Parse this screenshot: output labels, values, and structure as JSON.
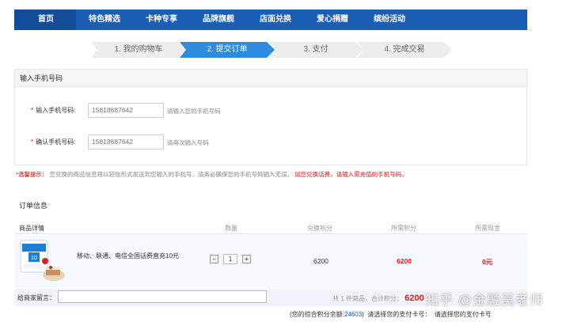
{
  "nav": [
    "首页",
    "特色精选",
    "卡种专享",
    "品牌旗舰",
    "店面兑换",
    "爱心捐赠",
    "缤纷活动"
  ],
  "steps": [
    {
      "label": "1. 我的购物车",
      "active": false
    },
    {
      "label": "2. 提交订单",
      "active": true
    },
    {
      "label": "3. 支付",
      "active": false
    },
    {
      "label": "4. 完成交易",
      "active": false
    }
  ],
  "phone": {
    "title": "输入手机号码",
    "star": "*",
    "label1": "输入手机号码:",
    "value1": "15818687642",
    "hint1": "请输入您的手机号码",
    "label2": "确认手机号码:",
    "value2": "15818687642",
    "hint2": "请再次输入号码"
  },
  "tip": {
    "label": "*温馨提示：",
    "text": "您兑换的商品信息将以短信形式发送到您输入的手机号，请务必确保您的手机号码输入无误。",
    "red": "如您兑换话费，请输入需充值的手机号码。"
  },
  "order": {
    "title": "订单信息",
    "headers": [
      "商品详情",
      "数量",
      "兑换积分",
      "所需积分",
      "所需现金"
    ],
    "product": {
      "name": "移动、联通、电信全国话费直充10元",
      "minus": "−",
      "qty": "1",
      "plus": "+",
      "points": "6200",
      "need_points": "6200",
      "cash": "0元"
    },
    "remark_label": "给商家留言：",
    "summary_text": "共 1 件商品，合计积分：",
    "summary_points": "6200",
    "balance_prefix": "(您的综合积分余额:",
    "balance": "24603",
    "balance_suffix": ")",
    "card_prompt1": "请选择您的支付卡号：",
    "card_prompt2": "请选择您的支付卡号"
  },
  "watermark": "知乎 @金融吴老师",
  "colors": {
    "nav": "#1b5fb4",
    "active_step": "#2d8be0",
    "red": "#d62020"
  }
}
